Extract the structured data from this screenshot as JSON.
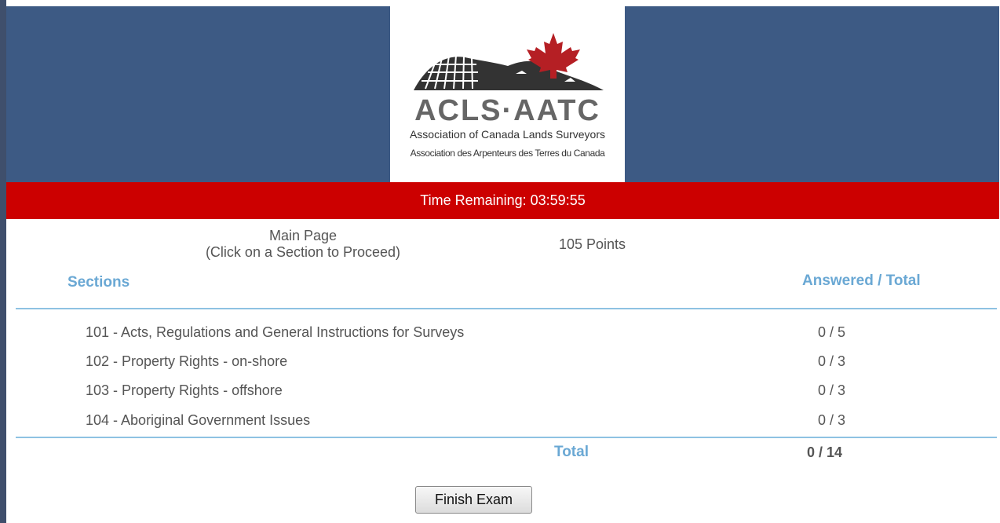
{
  "logo": {
    "acronym": "ACLS·AATC",
    "org_name_en": "Association of Canada Lands Surveyors",
    "org_name_fr": "Association des Arpenteurs des Terres du Canada",
    "colors": {
      "maple_leaf": "#b51f24",
      "hills": "#333333",
      "acronym": "#666666"
    }
  },
  "colors": {
    "header_background": "#3d5a84",
    "timer_background": "#cc0000",
    "column_heading": "#6aa8d4",
    "rule": "#8ec2e2",
    "body_text": "#555555"
  },
  "timer": {
    "text": "Time Remaining: 03:59:55"
  },
  "main": {
    "title": "Main Page",
    "hint": "(Click on a Section to Proceed)",
    "points": "105 Points",
    "columns": {
      "sections": "Sections",
      "answered_total": "Answered / Total"
    },
    "sections": [
      {
        "name": "101 - Acts, Regulations and General Instructions for Surveys",
        "count": "0 / 5"
      },
      {
        "name": "102 - Property Rights - on-shore",
        "count": "0 / 3"
      },
      {
        "name": "103 - Property Rights - offshore",
        "count": "0 / 3"
      },
      {
        "name": "104 - Aboriginal Government Issues",
        "count": "0 / 3"
      }
    ],
    "total_label": "Total",
    "total_value": "0 / 14"
  },
  "actions": {
    "finish_label": "Finish Exam"
  }
}
